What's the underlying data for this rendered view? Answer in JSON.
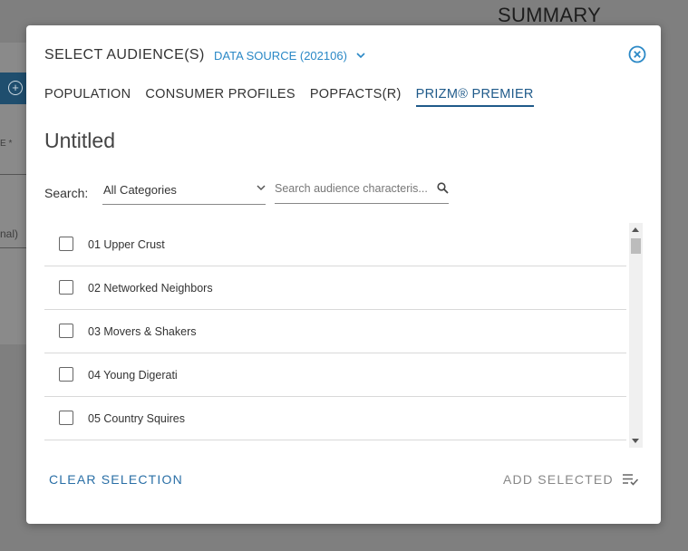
{
  "background": {
    "summary": "SUMMARY",
    "field_label": "E *",
    "optional": "nal)"
  },
  "modal": {
    "title": "SELECT AUDIENCE(S)",
    "data_source": "DATA SOURCE (202106)",
    "tabs": [
      {
        "label": "POPULATION",
        "active": false
      },
      {
        "label": "CONSUMER PROFILES",
        "active": false
      },
      {
        "label": "POPFACTS(R)",
        "active": false
      },
      {
        "label": "PRIZM® PREMIER",
        "active": true
      }
    ],
    "audience_name": "Untitled",
    "search": {
      "label": "Search:",
      "category": "All Categories",
      "placeholder": "Search audience characteris..."
    },
    "items": [
      {
        "label": "01 Upper Crust",
        "checked": false
      },
      {
        "label": "02 Networked Neighbors",
        "checked": false
      },
      {
        "label": "03 Movers & Shakers",
        "checked": false
      },
      {
        "label": "04 Young Digerati",
        "checked": false
      },
      {
        "label": "05 Country Squires",
        "checked": false
      }
    ],
    "clear_label": "CLEAR SELECTION",
    "add_label": "ADD SELECTED"
  },
  "colors": {
    "accent": "#2a88c6",
    "active_tab": "#1f5a8a",
    "overlay": "#7f7f7f"
  },
  "icons": [
    "plus-circle-icon",
    "chevron-down-icon",
    "close-circle-icon",
    "search-icon",
    "playlist-check-icon"
  ]
}
